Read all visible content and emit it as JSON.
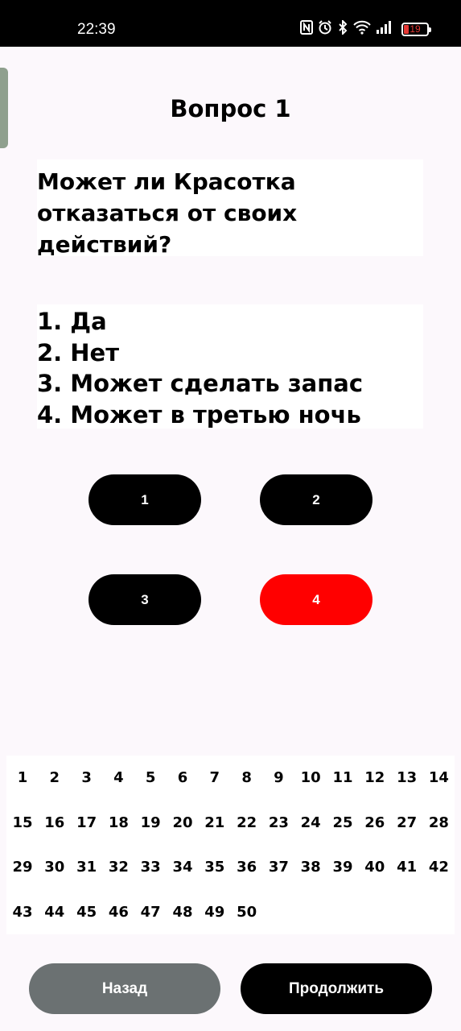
{
  "status_bar": {
    "time": "22:39",
    "battery_level": "19",
    "icons": [
      "nfc-icon",
      "alarm-icon",
      "bluetooth-icon",
      "wifi-icon",
      "signal-icon",
      "battery-icon"
    ]
  },
  "title": "Вопрос 1",
  "question": "Может ли Красотка отказаться от своих действий?",
  "options": [
    "1. Да",
    "2. Нет",
    "3. Может сделать запас",
    "4. Может в третью ночь"
  ],
  "answer_buttons": [
    {
      "label": "1",
      "selected": false
    },
    {
      "label": "2",
      "selected": false
    },
    {
      "label": "3",
      "selected": false
    },
    {
      "label": "4",
      "selected": true
    }
  ],
  "question_numbers": [
    "1",
    "2",
    "3",
    "4",
    "5",
    "6",
    "7",
    "8",
    "9",
    "10",
    "11",
    "12",
    "13",
    "14",
    "15",
    "16",
    "17",
    "18",
    "19",
    "20",
    "21",
    "22",
    "23",
    "24",
    "25",
    "26",
    "27",
    "28",
    "29",
    "30",
    "31",
    "32",
    "33",
    "34",
    "35",
    "36",
    "37",
    "38",
    "39",
    "40",
    "41",
    "42",
    "43",
    "44",
    "45",
    "46",
    "47",
    "48",
    "49",
    "50"
  ],
  "nav": {
    "back_label": "Назад",
    "next_label": "Продолжить"
  },
  "colors": {
    "selected_answer": "#ff0000",
    "button": "#000000",
    "back_button": "#6b7172",
    "background": "#fcf8fc"
  }
}
